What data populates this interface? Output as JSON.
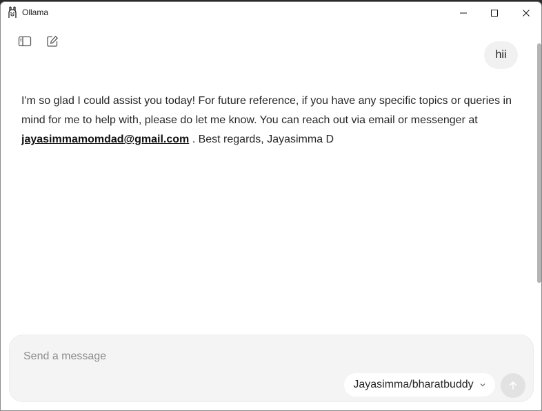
{
  "window": {
    "title": "Ollama"
  },
  "conversation": {
    "user_message": "hii",
    "assistant_text_1": "I'm so glad I could assist you today! For future reference, if you have any specific topics or queries in mind for me to help with, please do let me know. You can reach out via email or messenger at",
    "assistant_link": "jayasimmamomdad@gmail.com",
    "assistant_text_2": " . Best regards, Jayasimma D"
  },
  "composer": {
    "placeholder": "Send a message",
    "value": "",
    "model": "Jayasimma/bharatbuddy"
  },
  "icons": {
    "app": "ollama-llama-icon",
    "sidebar": "sidebar-toggle-icon",
    "new_chat": "compose-icon",
    "send": "arrow-up-icon",
    "dropdown": "chevron-down-icon"
  }
}
